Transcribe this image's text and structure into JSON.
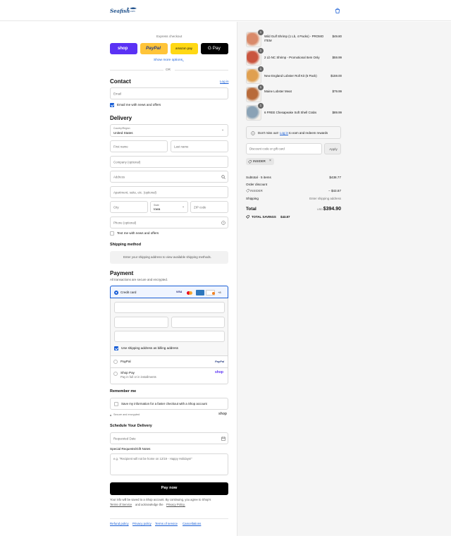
{
  "brand": {
    "logo_text": "Seafish",
    "logo_sub": ".com"
  },
  "express": {
    "title": "Express checkout",
    "shop": "shop",
    "paypal": "PayPal",
    "amazon": "amazon pay",
    "gpay": "G Pay",
    "more": "Show more options",
    "or": "OR"
  },
  "contact": {
    "title": "Contact",
    "login": "Log in",
    "email_ph": "Email",
    "news_label": "Email me with news and offers"
  },
  "delivery": {
    "title": "Delivery",
    "country_label": "Country/Region",
    "country_value": "United States",
    "first_ph": "First name",
    "last_ph": "Last name",
    "company_ph": "Company (optional)",
    "address_ph": "Address",
    "apt_ph": "Apartment, suite, etc. (optional)",
    "city_ph": "City",
    "state_label": "State",
    "state_value": "Iowa",
    "zip_ph": "ZIP code",
    "phone_ph": "Phone (optional)",
    "text_label": "Text me with news and offers"
  },
  "shipping": {
    "title": "Shipping method",
    "message": "Enter your shipping address to view available shipping methods."
  },
  "payment": {
    "title": "Payment",
    "subtitle": "All transactions are secure and encrypted.",
    "credit_card": "Credit card",
    "card_brands": [
      "VISA",
      "MC",
      "AMEX",
      "DISCOVER",
      "+8"
    ],
    "billing_label": "Use shipping address as billing address",
    "paypal": "PayPal",
    "paypal_logo": "PayPal",
    "shop_pay": "Shop Pay",
    "shop_pay_sub": "Pay in full or in installments",
    "shop_logo": "shop"
  },
  "remember": {
    "title": "Remember me",
    "label": "Save my information for a faster checkout with a Shop account",
    "secure": "Secure and encrypted",
    "shop_logo": "shop"
  },
  "schedule": {
    "title": "Schedule Your Delivery",
    "date_ph": "Requested Date",
    "notes_title": "Special Requests/Gift Notes",
    "notes_ph": "e.g. \"Recipient will not be home on 12/19 - Happy Holidays!\""
  },
  "pay_now": "Pay now",
  "disclaimer": {
    "line1": "Your info will be saved to a Shop account. By continuing, you agree to Shop's",
    "tos": "Terms of Service",
    "mid": "and acknowledge the",
    "privacy": "Privacy Policy."
  },
  "footer_links": [
    "Refund policy",
    "Privacy policy",
    "Terms of service",
    "Cancellations"
  ],
  "cart": {
    "items": [
      {
        "qty": "1",
        "name": "Wild Gulf Shrimp (1 Lb, 4 Packs) - PROMO",
        "name2": "ITEM",
        "price": "$49.80",
        "color": "#d98a6a"
      },
      {
        "qty": "1",
        "name": "2 Lb NC Shrimp - Promotional Item Only",
        "name2": "",
        "price": "$59.99",
        "color": "#c9553f"
      },
      {
        "qty": "1",
        "name": "New England Lobster Roll Kit (6 Pack)",
        "name2": "",
        "price": "$159.00",
        "color": "#e0a050"
      },
      {
        "qty": "1",
        "name": "Maine Lobster Meat",
        "name2": "",
        "price": "$79.99",
        "color": "#b86b3a"
      },
      {
        "qty": "1",
        "name": "6 FREE Chesapeake Soft Shell Crabs",
        "name2": "",
        "price": "$89.99",
        "color": "#8aa2b5"
      }
    ],
    "rewards": "Don't miss out!",
    "rewards_link": "Log in",
    "rewards_tail": "to earn and redeem rewards",
    "discount_ph": "Discount code or gift card",
    "apply": "Apply",
    "tag": "INSIDER",
    "subtotal_label": "Subtotal · 5 items",
    "subtotal": "$438.77",
    "order_discount": "Order discount",
    "discount_code": "INSIDER",
    "discount_value": "− $43.87",
    "shipping_label": "Shipping",
    "shipping_value": "Enter shipping address",
    "total_label": "Total",
    "currency": "USD",
    "total": "$394.90",
    "savings_label": "TOTAL SAVINGS",
    "savings": "$43.87"
  }
}
